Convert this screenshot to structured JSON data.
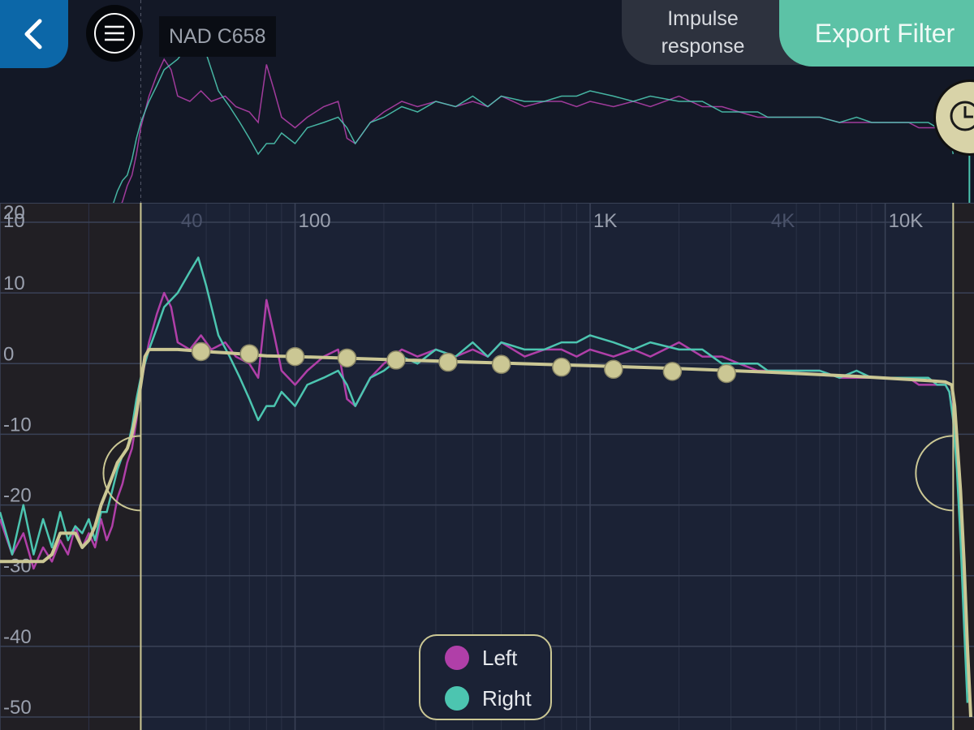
{
  "header": {
    "device_name": "NAD C658",
    "impulse_label_line1": "Impulse",
    "impulse_label_line2": "response",
    "export_label": "Export Filter",
    "back_icon": "chevron-left-icon",
    "menu_icon": "hamburger-menu-icon",
    "history_icon": "clock-icon"
  },
  "legend": {
    "items": [
      {
        "label": "Left",
        "color": "#b03fa8"
      },
      {
        "label": "Right",
        "color": "#4cc5b0"
      }
    ]
  },
  "colors": {
    "background": "#1b2235",
    "top_panel": "#131826",
    "target_curve": "#cbc794",
    "grid": "#3a4257",
    "export_accent": "#5cc2a6",
    "back_button": "#0c67a8"
  },
  "chart_data": {
    "type": "line",
    "x_scale": "log",
    "xlim": [
      10,
      20000
    ],
    "ylim": [
      -50,
      20
    ],
    "x_tick_labels": [
      {
        "value": 10,
        "label": "10"
      },
      {
        "value": 40,
        "label": "40"
      },
      {
        "value": 100,
        "label": "100"
      },
      {
        "value": 1000,
        "label": "1K"
      },
      {
        "value": 4000,
        "label": "4K"
      },
      {
        "value": 10000,
        "label": "10K"
      }
    ],
    "y_tick_labels": [
      {
        "value": 20,
        "label": "20"
      },
      {
        "value": 10,
        "label": "10"
      },
      {
        "value": 0,
        "label": "0"
      },
      {
        "value": -10,
        "label": "-10"
      },
      {
        "value": -20,
        "label": "-20"
      },
      {
        "value": -30,
        "label": "-30"
      },
      {
        "value": -40,
        "label": "-40"
      },
      {
        "value": -50,
        "label": "-50"
      }
    ],
    "filter_range_hz": [
      30,
      17000
    ],
    "series": [
      {
        "name": "Left",
        "color": "#b03fa8",
        "points": [
          [
            10,
            -22
          ],
          [
            11,
            -27
          ],
          [
            12,
            -24
          ],
          [
            13,
            -29
          ],
          [
            14,
            -26
          ],
          [
            15,
            -28
          ],
          [
            16,
            -25
          ],
          [
            17,
            -27
          ],
          [
            18,
            -23
          ],
          [
            19,
            -26
          ],
          [
            20,
            -24
          ],
          [
            21,
            -26
          ],
          [
            22,
            -22
          ],
          [
            23,
            -25
          ],
          [
            24,
            -23
          ],
          [
            25,
            -19
          ],
          [
            26,
            -17
          ],
          [
            27,
            -14
          ],
          [
            28,
            -12
          ],
          [
            29,
            -8
          ],
          [
            30,
            -3
          ],
          [
            32,
            3
          ],
          [
            34,
            7
          ],
          [
            36,
            10
          ],
          [
            38,
            8
          ],
          [
            40,
            3
          ],
          [
            44,
            2
          ],
          [
            48,
            4
          ],
          [
            52,
            2
          ],
          [
            58,
            3
          ],
          [
            63,
            1
          ],
          [
            70,
            0
          ],
          [
            75,
            -2
          ],
          [
            80,
            9
          ],
          [
            85,
            4
          ],
          [
            90,
            -1
          ],
          [
            100,
            -3
          ],
          [
            110,
            -1
          ],
          [
            125,
            1
          ],
          [
            140,
            2
          ],
          [
            150,
            -5
          ],
          [
            160,
            -6
          ],
          [
            180,
            -2
          ],
          [
            200,
            0
          ],
          [
            230,
            2
          ],
          [
            260,
            1
          ],
          [
            300,
            2
          ],
          [
            350,
            1
          ],
          [
            400,
            2
          ],
          [
            450,
            1
          ],
          [
            500,
            3
          ],
          [
            600,
            1
          ],
          [
            700,
            2
          ],
          [
            800,
            2
          ],
          [
            900,
            1
          ],
          [
            1000,
            2
          ],
          [
            1200,
            1
          ],
          [
            1400,
            2
          ],
          [
            1600,
            1
          ],
          [
            2000,
            3
          ],
          [
            2400,
            1
          ],
          [
            2800,
            1
          ],
          [
            3200,
            0
          ],
          [
            3700,
            -1
          ],
          [
            4000,
            -1
          ],
          [
            4500,
            -1
          ],
          [
            5000,
            -1
          ],
          [
            6000,
            -1
          ],
          [
            7000,
            -2
          ],
          [
            8000,
            -2
          ],
          [
            9000,
            -2
          ],
          [
            10000,
            -2
          ],
          [
            11000,
            -2
          ],
          [
            12000,
            -2
          ],
          [
            13000,
            -3
          ],
          [
            14000,
            -3
          ],
          [
            15000,
            -3
          ],
          [
            16000,
            -3
          ],
          [
            16500,
            -4
          ],
          [
            17000,
            -7
          ],
          [
            17500,
            -13
          ],
          [
            18000,
            -22
          ],
          [
            18500,
            -34
          ],
          [
            19000,
            -46
          ]
        ]
      },
      {
        "name": "Right",
        "color": "#4cc5b0",
        "points": [
          [
            10,
            -21
          ],
          [
            11,
            -27
          ],
          [
            12,
            -20
          ],
          [
            13,
            -27
          ],
          [
            14,
            -22
          ],
          [
            15,
            -26
          ],
          [
            16,
            -21
          ],
          [
            17,
            -25
          ],
          [
            18,
            -23
          ],
          [
            19,
            -24
          ],
          [
            20,
            -22
          ],
          [
            21,
            -25
          ],
          [
            22,
            -21
          ],
          [
            23,
            -21
          ],
          [
            24,
            -18
          ],
          [
            25,
            -15
          ],
          [
            26,
            -13
          ],
          [
            27,
            -12
          ],
          [
            28,
            -9
          ],
          [
            29,
            -5
          ],
          [
            30,
            -2
          ],
          [
            32,
            2
          ],
          [
            34,
            5
          ],
          [
            36,
            8
          ],
          [
            40,
            10
          ],
          [
            44,
            13
          ],
          [
            47,
            15
          ],
          [
            50,
            11
          ],
          [
            55,
            4
          ],
          [
            60,
            1
          ],
          [
            65,
            -2
          ],
          [
            70,
            -5
          ],
          [
            75,
            -8
          ],
          [
            80,
            -6
          ],
          [
            85,
            -6
          ],
          [
            90,
            -4
          ],
          [
            100,
            -6
          ],
          [
            110,
            -3
          ],
          [
            125,
            -2
          ],
          [
            140,
            -1
          ],
          [
            150,
            -3
          ],
          [
            160,
            -6
          ],
          [
            180,
            -2
          ],
          [
            200,
            -1
          ],
          [
            230,
            1
          ],
          [
            260,
            0
          ],
          [
            300,
            2
          ],
          [
            350,
            1
          ],
          [
            400,
            3
          ],
          [
            450,
            1
          ],
          [
            500,
            3
          ],
          [
            600,
            2
          ],
          [
            700,
            2
          ],
          [
            800,
            3
          ],
          [
            900,
            3
          ],
          [
            1000,
            4
          ],
          [
            1200,
            3
          ],
          [
            1400,
            2
          ],
          [
            1600,
            3
          ],
          [
            2000,
            2
          ],
          [
            2400,
            2
          ],
          [
            2800,
            0
          ],
          [
            3200,
            0
          ],
          [
            3700,
            0
          ],
          [
            4000,
            -1
          ],
          [
            4500,
            -1
          ],
          [
            5000,
            -1
          ],
          [
            6000,
            -1
          ],
          [
            7000,
            -2
          ],
          [
            8000,
            -1
          ],
          [
            9000,
            -2
          ],
          [
            10000,
            -2
          ],
          [
            11000,
            -2
          ],
          [
            12000,
            -2
          ],
          [
            13000,
            -2
          ],
          [
            14000,
            -2
          ],
          [
            15000,
            -3
          ],
          [
            16000,
            -3
          ],
          [
            16500,
            -4
          ],
          [
            17000,
            -8
          ],
          [
            17500,
            -15
          ],
          [
            18000,
            -25
          ],
          [
            18500,
            -37
          ],
          [
            19000,
            -48
          ]
        ]
      },
      {
        "name": "",
        "color": "#cbc794",
        "points": [
          [
            10,
            -28
          ],
          [
            12,
            -28
          ],
          [
            13,
            -28
          ],
          [
            14,
            -28
          ],
          [
            15,
            -27
          ],
          [
            16,
            -24
          ],
          [
            17,
            -24
          ],
          [
            18,
            -24
          ],
          [
            19,
            -26
          ],
          [
            20,
            -25
          ],
          [
            21,
            -23
          ],
          [
            22,
            -20
          ],
          [
            23,
            -18
          ],
          [
            24,
            -16
          ],
          [
            25,
            -14
          ],
          [
            26,
            -13
          ],
          [
            27,
            -12
          ],
          [
            28,
            -10
          ],
          [
            29,
            -7
          ],
          [
            30,
            -3
          ],
          [
            31,
            1
          ],
          [
            32,
            2
          ],
          [
            40,
            2
          ],
          [
            50,
            1.7
          ],
          [
            60,
            1.5
          ],
          [
            80,
            1.1
          ],
          [
            100,
            1
          ],
          [
            200,
            0.6
          ],
          [
            400,
            0.2
          ],
          [
            1000,
            -0.3
          ],
          [
            2000,
            -0.7
          ],
          [
            4000,
            -1.2
          ],
          [
            8000,
            -1.8
          ],
          [
            14000,
            -2.4
          ],
          [
            16000,
            -2.6
          ],
          [
            16800,
            -3
          ],
          [
            17200,
            -6
          ],
          [
            17600,
            -12
          ],
          [
            18000,
            -18
          ],
          [
            18500,
            -28
          ],
          [
            19000,
            -40
          ],
          [
            19500,
            -50
          ]
        ]
      }
    ],
    "control_points": [
      [
        48,
        1.7
      ],
      [
        70,
        1.4
      ],
      [
        100,
        1
      ],
      [
        150,
        0.8
      ],
      [
        220,
        0.5
      ],
      [
        330,
        0.2
      ],
      [
        500,
        -0.1
      ],
      [
        800,
        -0.5
      ],
      [
        1200,
        -0.8
      ],
      [
        1900,
        -1.1
      ],
      [
        2900,
        -1.4
      ]
    ]
  }
}
